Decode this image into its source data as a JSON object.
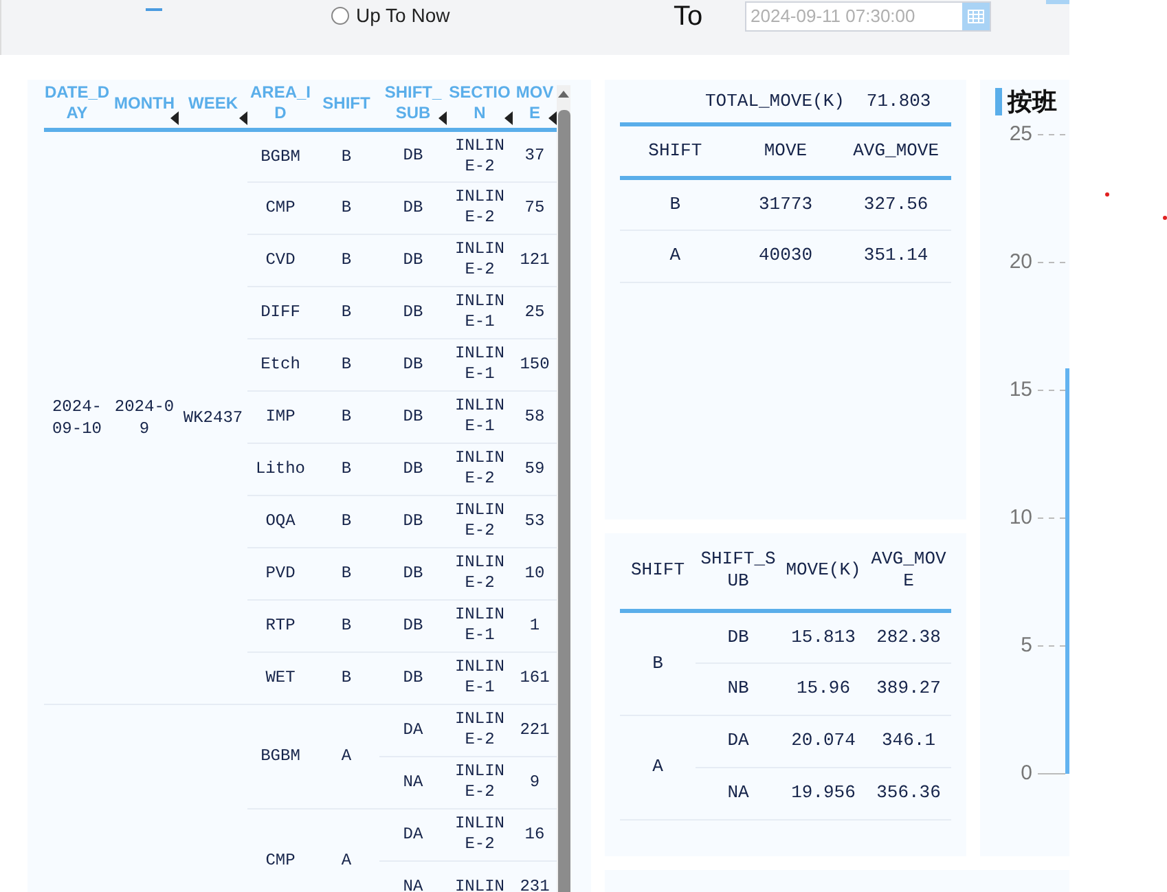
{
  "top_bar": {
    "tab_indicator": true,
    "radio": {
      "label": "Up To Now",
      "selected": false
    },
    "to_label": "To",
    "date_field": {
      "value": "2024-09-11 07:30:00"
    }
  },
  "detail_table": {
    "columns": [
      {
        "label": "DATE_DAY",
        "sortable": false
      },
      {
        "label": "MONTH",
        "sortable": true
      },
      {
        "label": "WEEK",
        "sortable": true
      },
      {
        "label": "AREA_ID",
        "sortable": false
      },
      {
        "label": "SHIFT",
        "sortable": false
      },
      {
        "label": "SHIFT_SUB",
        "sortable": true
      },
      {
        "label": "SECTION",
        "sortable": true
      },
      {
        "label": "MOVE",
        "sortable": true
      }
    ],
    "groups": [
      {
        "date_day": "2024-09-10",
        "month": "2024-09",
        "week": "WK2437",
        "areas": [
          {
            "area_id": "BGBM",
            "shift": "B",
            "subs": [
              {
                "shift_sub": "DB",
                "section": "INLINE-2",
                "move": "37"
              }
            ]
          },
          {
            "area_id": "CMP",
            "shift": "B",
            "subs": [
              {
                "shift_sub": "DB",
                "section": "INLINE-2",
                "move": "75"
              }
            ]
          },
          {
            "area_id": "CVD",
            "shift": "B",
            "subs": [
              {
                "shift_sub": "DB",
                "section": "INLINE-2",
                "move": "121"
              }
            ]
          },
          {
            "area_id": "DIFF",
            "shift": "B",
            "subs": [
              {
                "shift_sub": "DB",
                "section": "INLINE-1",
                "move": "25"
              }
            ]
          },
          {
            "area_id": "Etch",
            "shift": "B",
            "subs": [
              {
                "shift_sub": "DB",
                "section": "INLINE-1",
                "move": "150"
              }
            ]
          },
          {
            "area_id": "IMP",
            "shift": "B",
            "subs": [
              {
                "shift_sub": "DB",
                "section": "INLINE-1",
                "move": "58"
              }
            ]
          },
          {
            "area_id": "Litho",
            "shift": "B",
            "subs": [
              {
                "shift_sub": "DB",
                "section": "INLINE-2",
                "move": "59"
              }
            ]
          },
          {
            "area_id": "OQA",
            "shift": "B",
            "subs": [
              {
                "shift_sub": "DB",
                "section": "INLINE-2",
                "move": "53"
              }
            ]
          },
          {
            "area_id": "PVD",
            "shift": "B",
            "subs": [
              {
                "shift_sub": "DB",
                "section": "INLINE-2",
                "move": "10"
              }
            ]
          },
          {
            "area_id": "RTP",
            "shift": "B",
            "subs": [
              {
                "shift_sub": "DB",
                "section": "INLINE-1",
                "move": "1"
              }
            ]
          },
          {
            "area_id": "WET",
            "shift": "B",
            "subs": [
              {
                "shift_sub": "DB",
                "section": "INLINE-1",
                "move": "161"
              }
            ]
          }
        ]
      },
      {
        "areas": [
          {
            "area_id": "BGBM",
            "shift": "A",
            "subs": [
              {
                "shift_sub": "DA",
                "section": "INLINE-2",
                "move": "221"
              },
              {
                "shift_sub": "NA",
                "section": "INLINE-2",
                "move": "9"
              }
            ]
          },
          {
            "area_id": "CMP",
            "shift": "A",
            "subs": [
              {
                "shift_sub": "DA",
                "section": "INLINE-2",
                "move": "16"
              },
              {
                "shift_sub": "NA",
                "section": "INLIN",
                "move": "231"
              }
            ]
          }
        ]
      }
    ]
  },
  "total_card": {
    "label": "TOTAL_MOVE(K)",
    "value": "71.803",
    "columns": [
      "SHIFT",
      "MOVE",
      "AVG_MOVE"
    ],
    "rows": [
      [
        "B",
        "31773",
        "327.56"
      ],
      [
        "A",
        "40030",
        "351.14"
      ]
    ]
  },
  "sub_card": {
    "columns": [
      "SHIFT",
      "SHIFT_SUB",
      "MOVE(K)",
      "AVG_MOVE"
    ],
    "groups": [
      {
        "shift": "B",
        "rows": [
          [
            "DB",
            "15.813",
            "282.38"
          ],
          [
            "NB",
            "15.96",
            "389.27"
          ]
        ]
      },
      {
        "shift": "A",
        "rows": [
          [
            "DA",
            "20.074",
            "346.1"
          ],
          [
            "NA",
            "19.956",
            "356.36"
          ]
        ]
      }
    ]
  },
  "chart_card": {
    "title": "按班",
    "axis_labels": [
      "25",
      "20",
      "15",
      "10",
      "5",
      "0"
    ]
  },
  "marks": [
    {
      "color": "#e02020"
    },
    {
      "color": "#e02020"
    }
  ]
}
